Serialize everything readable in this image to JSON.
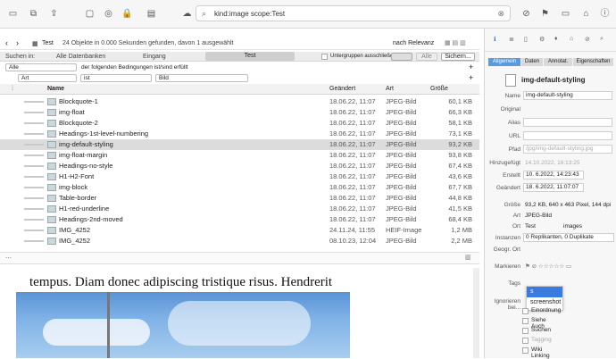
{
  "search": {
    "query": "kind:image scope:Test"
  },
  "nav": {
    "location": "Test",
    "status": "24 Objekte in 0.000 Sekunden gefunden, davon 1 ausgewählt",
    "sort": "nach Relevanz"
  },
  "scope": {
    "label": "Suchen in:",
    "all_db": "Alle Datenbanken",
    "inbox": "Eingang",
    "test": "Test",
    "exclude_groups": "Untergruppen ausschließen",
    "all_btn": "Alle",
    "search_btn": "Sichern..."
  },
  "filter": {
    "all": "Alle",
    "cond_text": "der folgenden Bedingungen ist/sind erfüllt",
    "field": "Art",
    "op": "ist",
    "value": "Bild"
  },
  "columns": {
    "name": "Name",
    "date": "Geändert",
    "kind": "Art",
    "size": "Größe"
  },
  "rows": [
    {
      "name": "Blockquote-1",
      "date": "18.06.22, 11:07",
      "kind": "JPEG-Bild",
      "size": "60,1 KB"
    },
    {
      "name": "img-float",
      "date": "18.06.22, 11:07",
      "kind": "JPEG-Bild",
      "size": "66,3 KB"
    },
    {
      "name": "Blockquote-2",
      "date": "18.06.22, 11:07",
      "kind": "JPEG-Bild",
      "size": "58,1 KB"
    },
    {
      "name": "Headings-1st-level-numbering",
      "date": "18.06.22, 11:07",
      "kind": "JPEG-Bild",
      "size": "73,1 KB"
    },
    {
      "name": "img-default-styling",
      "date": "18.06.22, 11:07",
      "kind": "JPEG-Bild",
      "size": "93,2 KB"
    },
    {
      "name": "img-float-margin",
      "date": "18.06.22, 11:07",
      "kind": "JPEG-Bild",
      "size": "93,8 KB"
    },
    {
      "name": "Headings-no-style",
      "date": "18.06.22, 11:07",
      "kind": "JPEG-Bild",
      "size": "67,4 KB"
    },
    {
      "name": "H1-H2-Font",
      "date": "18.06.22, 11:07",
      "kind": "JPEG-Bild",
      "size": "43,6 KB"
    },
    {
      "name": "img-block",
      "date": "18.06.22, 11:07",
      "kind": "JPEG-Bild",
      "size": "67,7 KB"
    },
    {
      "name": "Table-border",
      "date": "18.06.22, 11:07",
      "kind": "JPEG-Bild",
      "size": "44,8 KB"
    },
    {
      "name": "H1-red-underline",
      "date": "18.06.22, 11:07",
      "kind": "JPEG-Bild",
      "size": "41,5 KB"
    },
    {
      "name": "Headings-2nd-moved",
      "date": "18.06.22, 11:07",
      "kind": "JPEG-Bild",
      "size": "68,4 KB"
    },
    {
      "name": "IMG_4252",
      "date": "24.11.24, 11:55",
      "kind": "HEIF-Image",
      "size": "1,2 MB"
    },
    {
      "name": "IMG_4252",
      "date": "08.10.23, 12:04",
      "kind": "JPEG-Bild",
      "size": "2,2 MB"
    }
  ],
  "preview": {
    "text": "tempus. Diam donec adipiscing tristique risus. Hendrerit"
  },
  "inspector": {
    "tabs": [
      "Allgemein",
      "Daten",
      "Annotat.",
      "Eigenschaften"
    ],
    "title": "img-default-styling",
    "name_label": "Name",
    "name_value": "img-default-styling",
    "original_label": "Original",
    "alias_label": "Alias",
    "url_label": "URL",
    "path_label": "Pfad",
    "path_value": "/jpg/img-default-styling.jpg",
    "added_label": "Hinzugefügt",
    "added_value": "14.10.2022, 16:13:25",
    "created_label": "Erstellt",
    "created_value": "10. 6.2022, 14:23:43",
    "modified_label": "Geändert",
    "modified_value": "18. 6.2022, 11:07:07",
    "size_label": "Größe",
    "size_value": "93,2 KB, 640 x 463 Pixel, 144 dpi",
    "kind_label": "Art",
    "kind_value": "JPEG-Bild",
    "loc_label": "Ort",
    "loc_db": "Test",
    "loc_group": "images",
    "instances_label": "Instanzen",
    "instances_value": "0 Replikanten, 0 Duplikate",
    "geo_label": "Geogr. Ort",
    "mark_label": "Markieren",
    "tags_label": "Tags",
    "ignore_label": "Ignorieren bei...",
    "tag_options": [
      "s",
      "screenshot"
    ],
    "ignore_items": [
      "Einordnung",
      "Siehe Auch",
      "Suchen",
      "Tagging",
      "Wiki Linking"
    ]
  }
}
